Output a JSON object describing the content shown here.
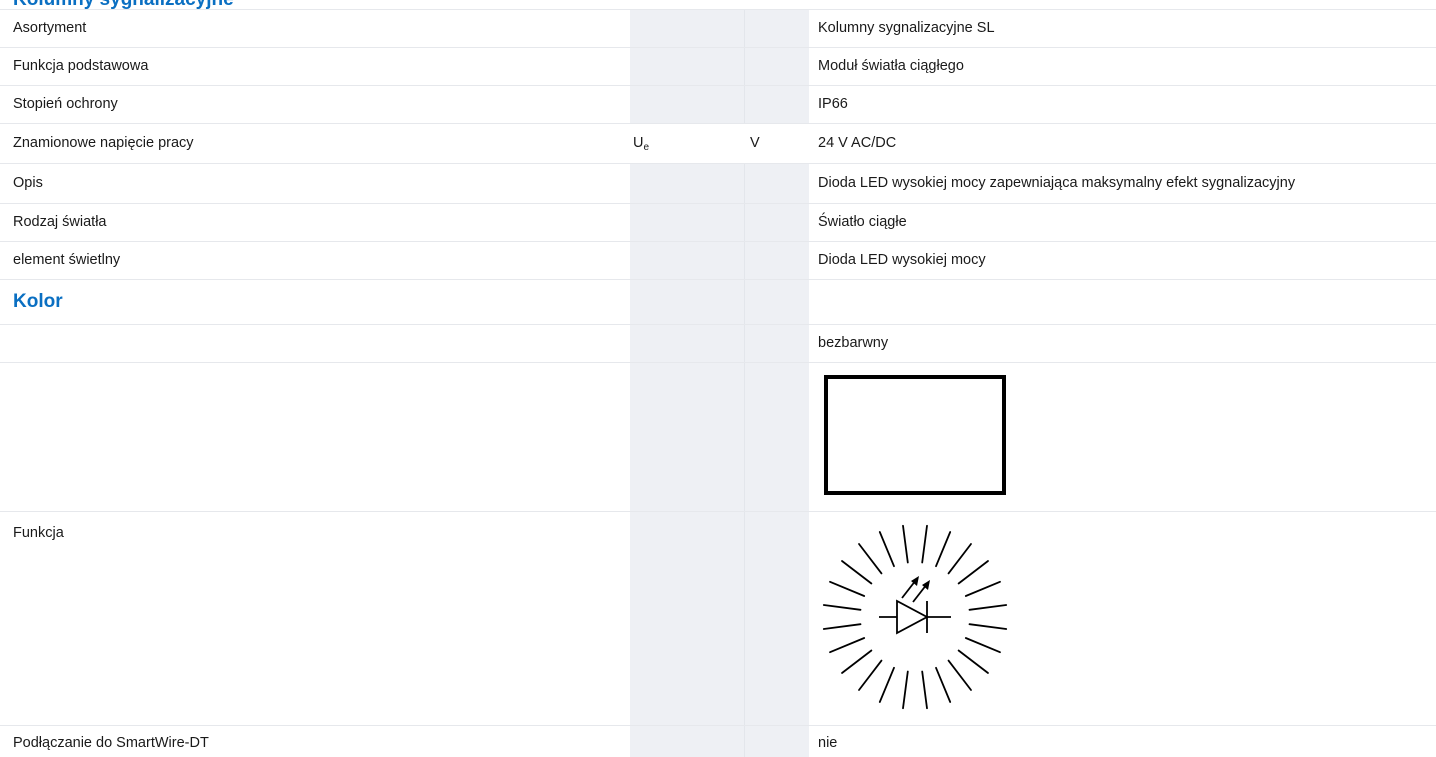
{
  "top_heading": "Kolumny sygnalizacyjne",
  "rows": [
    {
      "label": "Asortyment",
      "value": "Kolumny sygnalizacyjne SL"
    },
    {
      "label": "Funkcja podstawowa",
      "value": "Moduł światła ciągłego"
    },
    {
      "label": "Stopień ochrony",
      "value": "IP66"
    },
    {
      "label": "Znamionowe napięcie pracy",
      "symbol": "U",
      "symbol_sub": "e",
      "unit": "V",
      "value": "24 V AC/DC"
    },
    {
      "label": "Opis",
      "value": "Dioda LED wysokiej mocy zapewniająca maksymalny efekt sygnalizacyjny"
    },
    {
      "label": "Rodzaj światła",
      "value": "Światło ciągłe"
    },
    {
      "label": "element świetlny",
      "value": "Dioda LED wysokiej mocy"
    }
  ],
  "section": {
    "heading": "Kolor"
  },
  "color_value": "bezbarwny",
  "color_swatch": {
    "fill": "#ffffff",
    "border": "#000000"
  },
  "function_label": "Funkcja",
  "function_icon": "led-light-icon",
  "smartwire": {
    "label": "Podłączanie do SmartWire-DT",
    "value": "nie"
  },
  "colors": {
    "heading": "#0a6fc2",
    "shaded_column": "#eef0f4",
    "divider": "#e6e8ec"
  }
}
